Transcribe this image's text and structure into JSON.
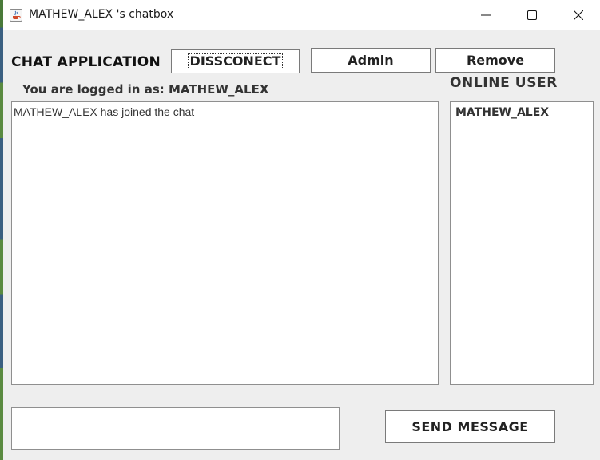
{
  "window": {
    "title": "MATHEW_ALEX 's chatbox",
    "controls": [
      "minimize-icon",
      "maximize-icon",
      "close-icon"
    ]
  },
  "header": {
    "app_title": "CHAT APPLICATION",
    "disconnect_label": "DISSCONECT",
    "admin_label": "Admin",
    "remove_label": "Remove"
  },
  "status": {
    "logged_in_text": "You are logged in as: MATHEW_ALEX"
  },
  "chat": {
    "messages": [
      "MATHEW_ALEX has joined the chat"
    ]
  },
  "online": {
    "heading": "ONLINE USER",
    "users": [
      "MATHEW_ALEX"
    ]
  },
  "composer": {
    "value": "",
    "send_label": "SEND MESSAGE"
  }
}
